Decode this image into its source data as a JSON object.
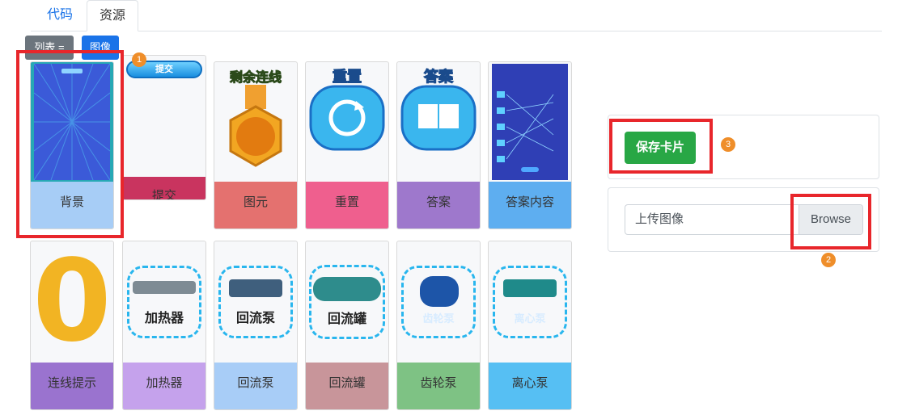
{
  "tabs": {
    "code": "代码",
    "resources": "资源"
  },
  "toolbar": {
    "list_label": "列表 =",
    "image_label": "图像"
  },
  "cards": [
    {
      "label": "背景",
      "color": "#a7cdf6"
    },
    {
      "label": "提交",
      "color": "#c9345f",
      "thumb_text": "提交"
    },
    {
      "label": "图元",
      "color": "#e4716f",
      "thumb_text": "剩余连线"
    },
    {
      "label": "重置",
      "color": "#ef5f8e",
      "thumb_text": "重置"
    },
    {
      "label": "答案",
      "color": "#9e78cc",
      "thumb_text": "答案"
    },
    {
      "label": "答案内容",
      "color": "#5eaef0"
    },
    {
      "label": "连线提示",
      "color": "#9a73cf",
      "thumb_text": "0"
    },
    {
      "label": "加热器",
      "color": "#c5a2ec",
      "thumb_text": "加热器"
    },
    {
      "label": "回流泵",
      "color": "#a8cdf7",
      "thumb_text": "回流泵"
    },
    {
      "label": "回流罐",
      "color": "#c8959a",
      "thumb_text": "回流罐"
    },
    {
      "label": "齿轮泵",
      "color": "#7ec284",
      "thumb_text": "齿轮泵"
    },
    {
      "label": "离心泵",
      "color": "#56bff3",
      "thumb_text": "离心泵"
    }
  ],
  "panel": {
    "save_label": "保存卡片",
    "upload_placeholder": "上传图像",
    "browse_label": "Browse"
  },
  "annotations": [
    "1",
    "2",
    "3"
  ],
  "colors": {
    "red_box": "#e8262b",
    "badge": "#ef8e2a",
    "save_green": "#28a745",
    "primary": "#1a73e8"
  }
}
